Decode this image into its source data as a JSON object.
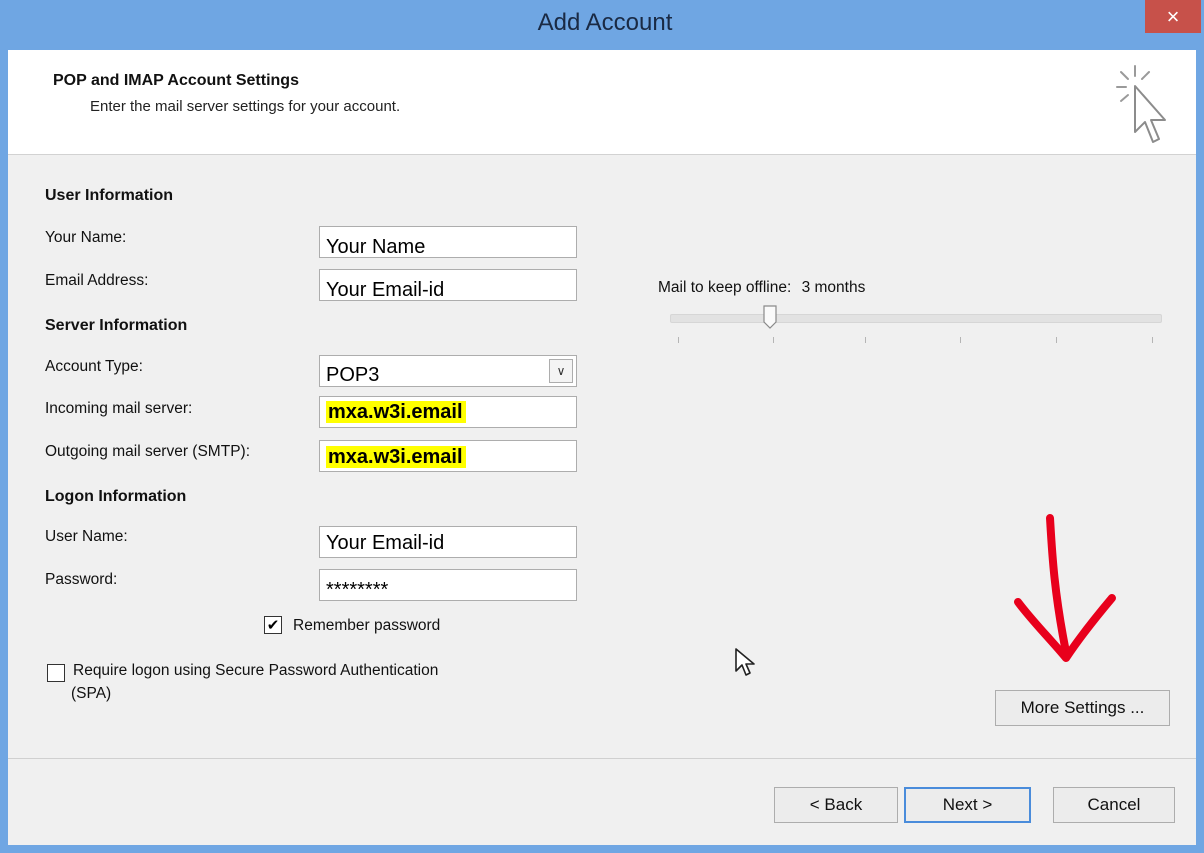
{
  "window": {
    "title": "Add Account",
    "close_glyph": "×"
  },
  "header": {
    "title": "POP and IMAP Account Settings",
    "subtitle": "Enter the mail server settings for your account.",
    "icon": "wizard-cursor-icon"
  },
  "user_info": {
    "heading": "User Information",
    "name_label": "Your Name:",
    "name_value": "Your Name",
    "email_label": "Email Address:",
    "email_value": "Your Email-id"
  },
  "server_info": {
    "heading": "Server Information",
    "account_type_label": "Account Type:",
    "account_type_value": "POP3",
    "incoming_label": "Incoming mail server:",
    "incoming_value": "mxa.w3i.email",
    "outgoing_label": "Outgoing mail server (SMTP):",
    "outgoing_value": "mxa.w3i.email"
  },
  "logon_info": {
    "heading": "Logon Information",
    "username_label": "User Name:",
    "username_value": "Your Email-id",
    "password_label": "Password:",
    "password_value": "********",
    "remember_label": "Remember password",
    "remember_checked": true,
    "spa_label_line1": "Require logon using Secure Password Authentication",
    "spa_label_line2": "(SPA)",
    "spa_checked": false
  },
  "offline": {
    "label": "Mail to keep offline:",
    "value": "3 months",
    "slider_fraction": 0.2
  },
  "buttons": {
    "more_settings": "More Settings ...",
    "back": "< Back",
    "next": "Next >",
    "cancel": "Cancel"
  },
  "colors": {
    "titlebar": "#6fa6e3",
    "close": "#c7514a",
    "highlight": "#ffff00",
    "annotation_arrow": "#e8001c"
  }
}
